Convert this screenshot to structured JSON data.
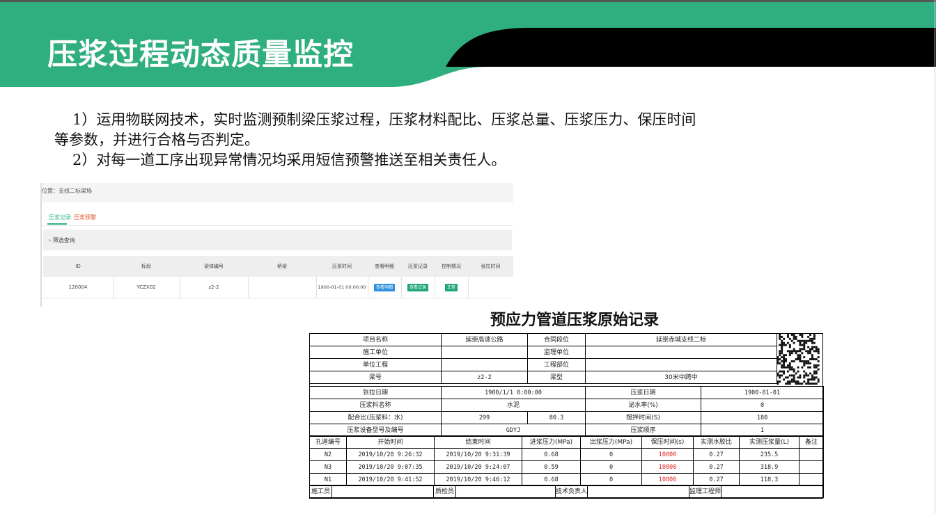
{
  "title": "压浆过程动态质量监控",
  "colors": {
    "brand_green": "#2fae7f",
    "banner_black": "#000000",
    "link_red": "#e02020"
  },
  "paragraphs": {
    "p1_line1": "1）运用物联网技术，实时监测预制梁压浆过程，压浆材料配比、压浆总量、压浆压力、保压时间",
    "p1_line2": "等参数，并进行合格与否判定。",
    "p2": "2）对每一道工序出现异常情况均采用短信预警推送至相关责任人。"
  },
  "screenshot": {
    "location": "位置：支线二标梁场",
    "tabs": [
      "压浆记录",
      "压浆预警"
    ],
    "filter_label": "›  筛选查询",
    "headers": [
      "ID",
      "标段",
      "梁体编号",
      "桥梁",
      "压浆时间",
      "查看明细",
      "压浆记录",
      "控制情况",
      "张拉时间"
    ],
    "row": {
      "id": "120004",
      "section": "YCZX02",
      "beam_no": "z2-2",
      "bridge": "",
      "grout_time": "1900-01-01 00:00:00",
      "detail_btn": "查看明细",
      "record_btn": "查看记录",
      "control_btn": "正常",
      "tension_time": ""
    }
  },
  "record": {
    "title": "预应力管道压浆原始记录",
    "info": {
      "project_name_label": "项目名称",
      "project_name": "延崇高速公路",
      "contract_label": "合同段位",
      "contract": "延崇赤城支线二标",
      "construction_unit_label": "施工单位",
      "construction_unit": "",
      "supervision_unit_label": "监理单位",
      "supervision_unit": "",
      "unit_project_label": "单位工程",
      "unit_project": "",
      "project_part_label": "工程部位",
      "project_part": "",
      "beam_no_label": "梁号",
      "beam_no": "z2-2",
      "beam_type_label": "梁型",
      "beam_type": "30米中跨中",
      "tension_date_label": "张拉日期",
      "tension_date": "1900/1/1 0:00:00",
      "grout_date_label": "压浆日期",
      "grout_date": "1900-01-01",
      "material_label": "压浆料名称",
      "material": "水泥",
      "bleeding_label": "泌水率(%)",
      "bleeding": "0",
      "ratio_label": "配合比(压浆料：水)",
      "ratio_a": "299",
      "ratio_b": "80.3",
      "mixing_label": "搅拌时间(S)",
      "mixing": "180",
      "equipment_label": "压浆设备型号及编号",
      "equipment": "GDYJ",
      "order_label": "压浆顺序",
      "order": "1"
    },
    "columns": [
      "孔道编号",
      "开始时间",
      "结束时间",
      "进浆压力(MPa)",
      "出浆压力(MPa)",
      "保压时间(s)",
      "实测水胶比",
      "实测压浆量(L)",
      "备注"
    ],
    "rows": [
      [
        "N2",
        "2019/10/20 9:26:32",
        "2019/10/20 9:31:39",
        "0.68",
        "0",
        "10800",
        "0.27",
        "235.5",
        ""
      ],
      [
        "N3",
        "2019/10/20 9:07:35",
        "2019/10/20 9:24:07",
        "0.59",
        "0",
        "10800",
        "0.27",
        "318.9",
        ""
      ],
      [
        "N1",
        "2019/10/20 9:41:52",
        "2019/10/20 9:46:12",
        "0.68",
        "0",
        "10800",
        "0.27",
        "118.3",
        ""
      ]
    ],
    "signatures": [
      "施工员",
      "质检员",
      "技术负责人",
      "监理工程师"
    ]
  }
}
